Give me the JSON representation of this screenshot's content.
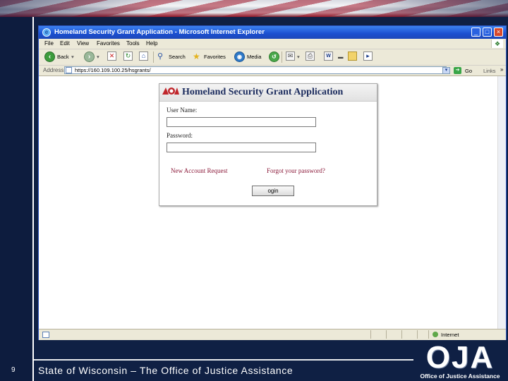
{
  "slide": {
    "number": "9",
    "footer": "State of Wisconsin – The Office of Justice Assistance",
    "logo_text": "OJA",
    "logo_subtext": "Office of Justice Assistance"
  },
  "browser": {
    "title": "Homeland Security Grant Application - Microsoft Internet Explorer",
    "menu": [
      "File",
      "Edit",
      "View",
      "Favorites",
      "Tools",
      "Help"
    ],
    "toolbar": {
      "back": "Back",
      "search": "Search",
      "favorites": "Favorites",
      "media": "Media"
    },
    "address": {
      "label": "Address",
      "url": "https://160.109.100.25/hsgrants/",
      "go": "Go",
      "links": "Links",
      "more": "»"
    },
    "status": {
      "zone": "Internet"
    }
  },
  "login": {
    "title": "Homeland Security Grant Application",
    "username_label": "User Name:",
    "password_label": "Password:",
    "new_account_link": "New Account Request",
    "forgot_link": "Forgot your password?",
    "login_button": "ogin"
  },
  "colors": {
    "slide_bg": "#0f2044",
    "titlebar": "#1b4fd0",
    "link": "#8b1a3a",
    "title_text": "#1c2c5e"
  }
}
